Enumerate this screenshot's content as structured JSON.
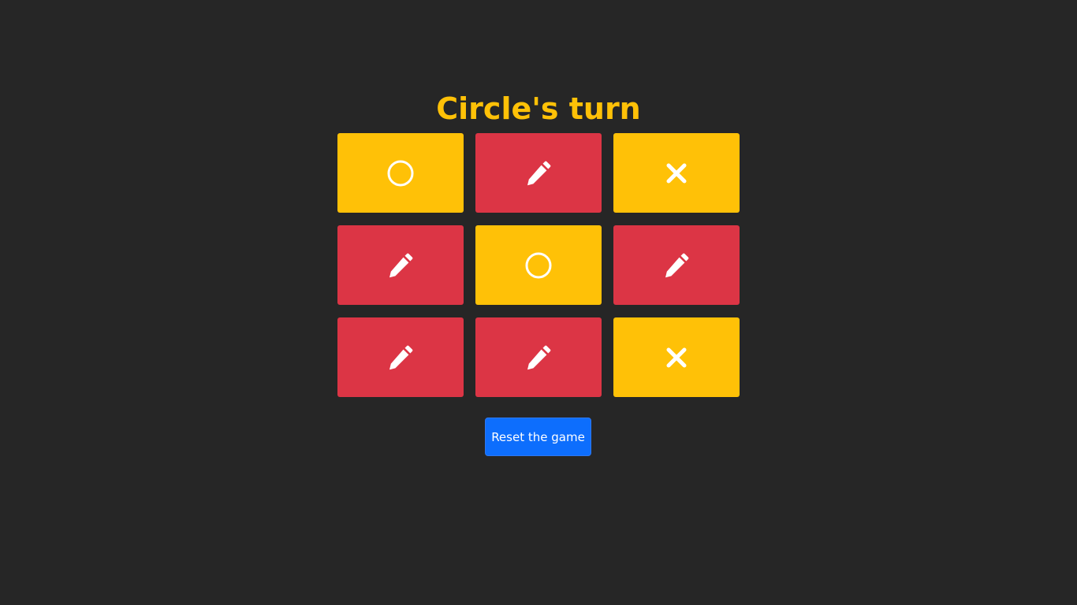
{
  "status": {
    "title": "Circle's turn",
    "title_color": "#ffc107"
  },
  "board": {
    "cells": [
      {
        "state": "circle",
        "icon": "circle-icon"
      },
      {
        "state": "empty",
        "icon": "pencil-icon"
      },
      {
        "state": "cross",
        "icon": "x-mark-icon"
      },
      {
        "state": "empty",
        "icon": "pencil-icon"
      },
      {
        "state": "circle",
        "icon": "circle-icon"
      },
      {
        "state": "empty",
        "icon": "pencil-icon"
      },
      {
        "state": "empty",
        "icon": "pencil-icon"
      },
      {
        "state": "empty",
        "icon": "pencil-icon"
      },
      {
        "state": "cross",
        "icon": "x-mark-icon"
      }
    ],
    "colors": {
      "filled": "#ffc107",
      "empty": "#dc3545",
      "icon": "#ffffff"
    }
  },
  "controls": {
    "reset_label": "Reset the game",
    "reset_color": "#0d6efd"
  }
}
